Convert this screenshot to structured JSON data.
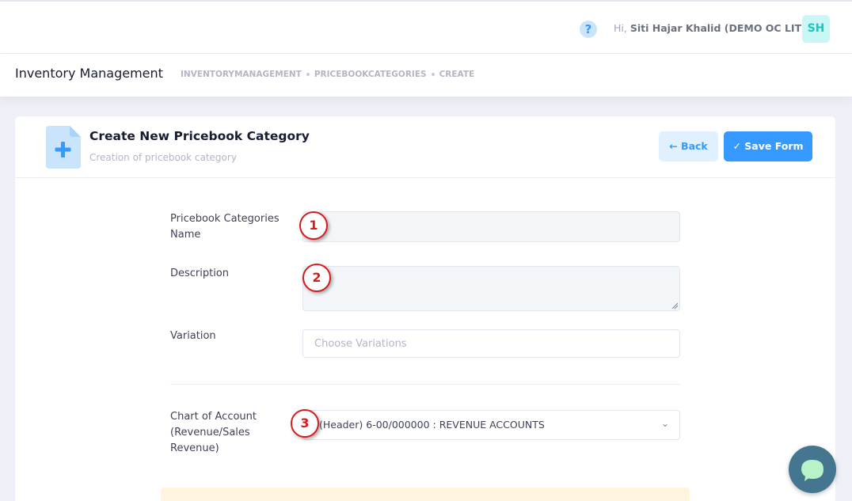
{
  "topbar": {
    "help_icon": "question-circle-icon",
    "greeting_prefix": "Hi,",
    "user_name": "Siti Hajar Khalid (DEMO OC LITE)",
    "avatar_initials": "SH"
  },
  "subheader": {
    "title": "Inventory Management",
    "breadcrumb": [
      "INVENTORYMANAGEMENT",
      "PRICEBOOKCATEGORIES",
      "CREATE"
    ]
  },
  "card": {
    "title": "Create New Pricebook Category",
    "subtitle": "Creation of pricebook category",
    "back_label": "← Back",
    "save_label": "✓ Save Form"
  },
  "form": {
    "name_label": "Pricebook Categories Name",
    "name_value": "",
    "description_label": "Description",
    "description_value": "",
    "variation_label": "Variation",
    "variation_placeholder": "Choose Variations",
    "coa_label": "Chart of Account (Revenue/Sales Revenue)",
    "coa_value": "(Header) 6-00/000000 : REVENUE ACCOUNTS"
  },
  "markers": [
    "1",
    "2",
    "3"
  ],
  "colors": {
    "primary": "#3699ff",
    "primary_light": "#e1f0ff",
    "marker_red": "#d61c1c",
    "chat_bubble": "#44778f",
    "chat_icon": "#b9f2c8"
  }
}
